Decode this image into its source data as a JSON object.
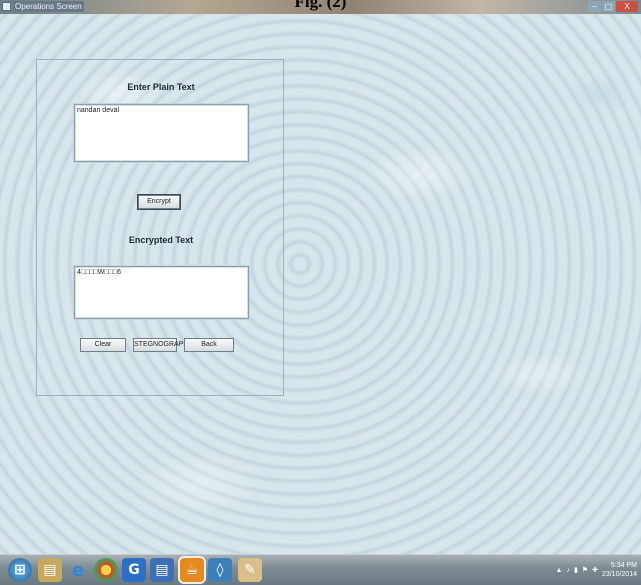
{
  "caption": "Fig. (2)",
  "window": {
    "title": "Operations Screen",
    "min": "–",
    "max": "▢",
    "close": "X"
  },
  "form": {
    "plain_label": "Enter Plain Text",
    "plain_value": "nandan deval",
    "encrypt_button": "Encrypt",
    "encrypted_label": "Encrypted Text",
    "encrypted_value": "4□□□□W□□□6",
    "clear_button": "Clear",
    "steg_button": "STEGNOGRAPHY",
    "back_button": "Back"
  },
  "taskbar": {
    "items": [
      "start-orb",
      "file-explorer",
      "internet-explorer",
      "chrome",
      "g-app",
      "word-app",
      "java-app",
      "virtualbox",
      "notepad-app"
    ],
    "tray_arrow": "▲",
    "time": "5:34 PM",
    "date": "23/10/2014"
  },
  "colors": {
    "desktop": "#d3e3e9",
    "taskbar": "#7d8b93",
    "close": "#c8523f"
  }
}
